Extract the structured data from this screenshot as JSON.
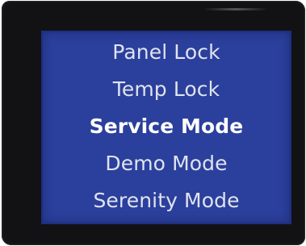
{
  "menu": {
    "items": [
      {
        "label": "Panel Lock",
        "selected": false
      },
      {
        "label": "Temp Lock",
        "selected": false
      },
      {
        "label": "Service Mode",
        "selected": true
      },
      {
        "label": "Demo Mode",
        "selected": false
      },
      {
        "label": "Serenity Mode",
        "selected": false
      }
    ]
  },
  "colors": {
    "screen_background": "#2b3f9c",
    "bezel": "#121214",
    "item_text": "#dfe3ee",
    "selected_text": "#ffffff"
  }
}
